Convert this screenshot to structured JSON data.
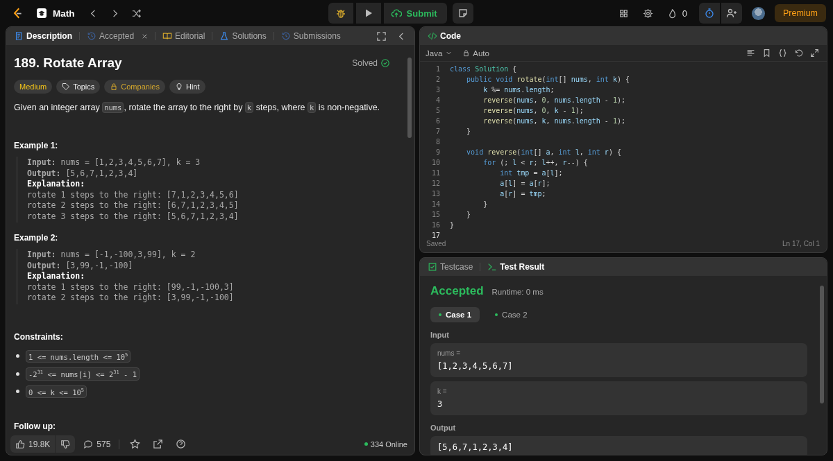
{
  "navbar": {
    "problem_list": "Math",
    "submit": "Submit",
    "streak": "0",
    "premium": "Premium"
  },
  "description": {
    "tabs": [
      {
        "kind": "description",
        "label": "Description",
        "selected": true,
        "closable": false
      },
      {
        "kind": "accepted",
        "label": "Accepted",
        "selected": false,
        "closable": true
      },
      {
        "kind": "editorial",
        "label": "Editorial",
        "selected": false,
        "closable": false
      },
      {
        "kind": "solutions",
        "label": "Solutions",
        "selected": false,
        "closable": false
      },
      {
        "kind": "submissions",
        "label": "Submissions",
        "selected": false,
        "closable": false
      }
    ],
    "title": "189. Rotate Array",
    "status": "Solved",
    "tags": [
      {
        "kind": "difficulty",
        "label": "Medium"
      },
      {
        "kind": "topics",
        "label": "Topics"
      },
      {
        "kind": "companies",
        "label": "Companies"
      },
      {
        "kind": "hint",
        "label": "Hint"
      }
    ],
    "statement": [
      {
        "text": "Given an integer array ",
        "code": false
      },
      {
        "text": "nums",
        "code": true
      },
      {
        "text": ", rotate the array to the right by ",
        "code": false
      },
      {
        "text": "k",
        "code": true
      },
      {
        "text": " steps, where ",
        "code": false
      },
      {
        "text": "k",
        "code": true
      },
      {
        "text": " is non-negative.",
        "code": false
      }
    ],
    "examples": [
      {
        "heading": "Example 1:",
        "lines": [
          {
            "kind": "field",
            "text": "**Input:** nums = [1,2,3,4,5,6,7], k = 3"
          },
          {
            "kind": "field",
            "text": "**Output:** [5,6,7,1,2,3,4]"
          },
          {
            "kind": "heading",
            "text": "Explanation:"
          },
          {
            "kind": "plain",
            "text": "rotate 1 steps to the right: [7,1,2,3,4,5,6]"
          },
          {
            "kind": "plain",
            "text": "rotate 2 steps to the right: [6,7,1,2,3,4,5]"
          },
          {
            "kind": "plain",
            "text": "rotate 3 steps to the right: [5,6,7,1,2,3,4]"
          }
        ]
      },
      {
        "heading": "Example 2:",
        "lines": [
          {
            "kind": "field",
            "text": "**Input:** nums = [-1,-100,3,99], k = 2"
          },
          {
            "kind": "field",
            "text": "**Output:** [3,99,-1,-100]"
          },
          {
            "kind": "heading",
            "text": "Explanation:"
          },
          {
            "kind": "plain",
            "text": "rotate 1 steps to the right: [99,-1,-100,3]"
          },
          {
            "kind": "plain",
            "text": "rotate 2 steps to the right: [3,99,-1,-100]"
          }
        ]
      }
    ],
    "constraints_heading": "Constraints:",
    "constraints": [
      "1 <= nums.length <= 10$^{5}$",
      "-2$^{31}$ <= nums[i] <= 2$^{31}$ - 1",
      "0 <= k <= 10$^{5}$"
    ],
    "follow_up_heading": "Follow up:",
    "footer": {
      "likes": "19.8K",
      "comments": "575",
      "online": "334 Online"
    }
  },
  "code_editor": {
    "title": "Code",
    "language": "Java",
    "mode": "Auto",
    "lines": [
      {
        "number": "1",
        "active": false,
        "tokens": [
          {
            "text": "class",
            "kind": "kw"
          },
          {
            "text": " Solution",
            "kind": "type"
          },
          {
            "text": " {",
            "kind": "plain"
          }
        ]
      },
      {
        "number": "2",
        "active": false,
        "tokens": [
          {
            "text": "    public",
            "kind": "kw"
          },
          {
            "text": " void",
            "kind": "kw"
          },
          {
            "text": " rotate",
            "kind": "fn"
          },
          {
            "text": "(",
            "kind": "plain"
          },
          {
            "text": "int",
            "kind": "kw"
          },
          {
            "text": "[]",
            "kind": "plain"
          },
          {
            "text": " nums",
            "kind": "var"
          },
          {
            "text": ",",
            "kind": "plain"
          },
          {
            "text": " int",
            "kind": "kw"
          },
          {
            "text": " k",
            "kind": "var"
          },
          {
            "text": ") {",
            "kind": "plain"
          }
        ]
      },
      {
        "number": "3",
        "active": false,
        "tokens": [
          {
            "text": "        k",
            "kind": "var"
          },
          {
            "text": " %=",
            "kind": "plain"
          },
          {
            "text": " nums",
            "kind": "var"
          },
          {
            "text": ".",
            "kind": "plain"
          },
          {
            "text": "length",
            "kind": "var"
          },
          {
            "text": ";",
            "kind": "plain"
          }
        ]
      },
      {
        "number": "4",
        "active": false,
        "tokens": [
          {
            "text": "        reverse",
            "kind": "fn"
          },
          {
            "text": "(",
            "kind": "plain"
          },
          {
            "text": "nums",
            "kind": "var"
          },
          {
            "text": ",",
            "kind": "plain"
          },
          {
            "text": " 0",
            "kind": "num"
          },
          {
            "text": ",",
            "kind": "plain"
          },
          {
            "text": " nums",
            "kind": "var"
          },
          {
            "text": ".",
            "kind": "plain"
          },
          {
            "text": "length",
            "kind": "var"
          },
          {
            "text": " -",
            "kind": "plain"
          },
          {
            "text": " 1",
            "kind": "num"
          },
          {
            "text": ");",
            "kind": "plain"
          }
        ]
      },
      {
        "number": "5",
        "active": false,
        "tokens": [
          {
            "text": "        reverse",
            "kind": "fn"
          },
          {
            "text": "(",
            "kind": "plain"
          },
          {
            "text": "nums",
            "kind": "var"
          },
          {
            "text": ",",
            "kind": "plain"
          },
          {
            "text": " 0",
            "kind": "num"
          },
          {
            "text": ",",
            "kind": "plain"
          },
          {
            "text": " k",
            "kind": "var"
          },
          {
            "text": " -",
            "kind": "plain"
          },
          {
            "text": " 1",
            "kind": "num"
          },
          {
            "text": ");",
            "kind": "plain"
          }
        ]
      },
      {
        "number": "6",
        "active": false,
        "tokens": [
          {
            "text": "        reverse",
            "kind": "fn"
          },
          {
            "text": "(",
            "kind": "plain"
          },
          {
            "text": "nums",
            "kind": "var"
          },
          {
            "text": ",",
            "kind": "plain"
          },
          {
            "text": " k",
            "kind": "var"
          },
          {
            "text": ",",
            "kind": "plain"
          },
          {
            "text": " nums",
            "kind": "var"
          },
          {
            "text": ".",
            "kind": "plain"
          },
          {
            "text": "length",
            "kind": "var"
          },
          {
            "text": " -",
            "kind": "plain"
          },
          {
            "text": " 1",
            "kind": "num"
          },
          {
            "text": ");",
            "kind": "plain"
          }
        ]
      },
      {
        "number": "7",
        "active": false,
        "tokens": [
          {
            "text": "    }",
            "kind": "plain"
          }
        ]
      },
      {
        "number": "8",
        "active": false
      },
      {
        "number": "9",
        "active": false,
        "tokens": [
          {
            "text": "    void",
            "kind": "kw"
          },
          {
            "text": " reverse",
            "kind": "fn"
          },
          {
            "text": "(",
            "kind": "plain"
          },
          {
            "text": "int",
            "kind": "kw"
          },
          {
            "text": "[]",
            "kind": "plain"
          },
          {
            "text": " a",
            "kind": "var"
          },
          {
            "text": ",",
            "kind": "plain"
          },
          {
            "text": " int",
            "kind": "kw"
          },
          {
            "text": " l",
            "kind": "var"
          },
          {
            "text": ",",
            "kind": "plain"
          },
          {
            "text": " int",
            "kind": "kw"
          },
          {
            "text": " r",
            "kind": "var"
          },
          {
            "text": ") {",
            "kind": "plain"
          }
        ]
      },
      {
        "number": "10",
        "active": false,
        "tokens": [
          {
            "text": "        for",
            "kind": "kw"
          },
          {
            "text": " (;",
            "kind": "plain"
          },
          {
            "text": " l",
            "kind": "var"
          },
          {
            "text": " <",
            "kind": "plain"
          },
          {
            "text": " r",
            "kind": "var"
          },
          {
            "text": ";",
            "kind": "plain"
          },
          {
            "text": " l",
            "kind": "var"
          },
          {
            "text": "++,",
            "kind": "plain"
          },
          {
            "text": " r",
            "kind": "var"
          },
          {
            "text": "--) {",
            "kind": "plain"
          }
        ]
      },
      {
        "number": "11",
        "active": false,
        "tokens": [
          {
            "text": "            int",
            "kind": "kw"
          },
          {
            "text": " tmp",
            "kind": "var"
          },
          {
            "text": " =",
            "kind": "plain"
          },
          {
            "text": " a",
            "kind": "var"
          },
          {
            "text": "[",
            "kind": "plain"
          },
          {
            "text": "l",
            "kind": "var"
          },
          {
            "text": "];",
            "kind": "plain"
          }
        ]
      },
      {
        "number": "12",
        "active": false,
        "tokens": [
          {
            "text": "            a",
            "kind": "var"
          },
          {
            "text": "[",
            "kind": "plain"
          },
          {
            "text": "l",
            "kind": "var"
          },
          {
            "text": "] =",
            "kind": "plain"
          },
          {
            "text": " a",
            "kind": "var"
          },
          {
            "text": "[",
            "kind": "plain"
          },
          {
            "text": "r",
            "kind": "var"
          },
          {
            "text": "];",
            "kind": "plain"
          }
        ]
      },
      {
        "number": "13",
        "active": false,
        "tokens": [
          {
            "text": "            a",
            "kind": "var"
          },
          {
            "text": "[",
            "kind": "plain"
          },
          {
            "text": "r",
            "kind": "var"
          },
          {
            "text": "] =",
            "kind": "plain"
          },
          {
            "text": " tmp",
            "kind": "var"
          },
          {
            "text": ";",
            "kind": "plain"
          }
        ]
      },
      {
        "number": "14",
        "active": false,
        "tokens": [
          {
            "text": "        }",
            "kind": "plain"
          }
        ]
      },
      {
        "number": "15",
        "active": false,
        "tokens": [
          {
            "text": "    }",
            "kind": "plain"
          }
        ]
      },
      {
        "number": "16",
        "active": false,
        "tokens": [
          {
            "text": "}",
            "kind": "plain"
          }
        ]
      },
      {
        "number": "17",
        "active": true
      }
    ],
    "status": "Saved",
    "cursor": "Ln 17, Col 1"
  },
  "test_panel": {
    "tabs": [
      {
        "kind": "testcase",
        "label": "Testcase",
        "selected": false
      },
      {
        "kind": "result",
        "label": "Test Result",
        "selected": true
      }
    ],
    "verdict": "Accepted",
    "runtime": "Runtime: 0 ms",
    "cases": [
      {
        "label": "Case 1",
        "selected": true,
        "passed": true
      },
      {
        "label": "Case 2",
        "selected": false,
        "passed": true
      }
    ],
    "input_label": "Input",
    "inputs": [
      {
        "name": "nums =",
        "value": "[1,2,3,4,5,6,7]"
      },
      {
        "name": "k =",
        "value": "3"
      }
    ],
    "output_label": "Output",
    "output": "[5,6,7,1,2,3,4]"
  }
}
